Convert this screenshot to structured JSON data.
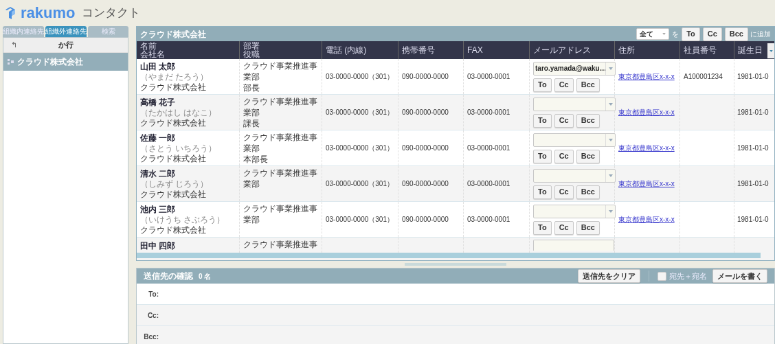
{
  "header": {
    "logo": "rakumo",
    "app_name": "コンタクト"
  },
  "sidebar": {
    "tabs": [
      {
        "label": "組織内連絡先",
        "selected": false
      },
      {
        "label": "組織外連絡先",
        "selected": true
      },
      {
        "label": "検索",
        "selected": false
      }
    ],
    "group_header": {
      "back": "↰",
      "label": "か行"
    },
    "items": [
      {
        "label": "クラウド株式会社",
        "selected": true
      }
    ]
  },
  "contacts": {
    "title": "クラウド株式会社",
    "toolbar": {
      "scope": "全て",
      "joiner": "を",
      "buttons": [
        "To",
        "Cc",
        "Bcc"
      ],
      "suffix": "に追加"
    },
    "columns": [
      [
        "名前",
        "会社名"
      ],
      [
        "部署",
        "役職"
      ],
      [
        "電話 (内線)"
      ],
      [
        "携帯番号"
      ],
      [
        "FAX"
      ],
      [
        "メールアドレス"
      ],
      [
        "住所"
      ],
      [
        "社員番号"
      ],
      [
        "誕生日"
      ]
    ],
    "rows": [
      {
        "kind": "full",
        "name": "山田 太郎",
        "reading": "（やまだ たろう）",
        "company": "クラウド株式会社",
        "department": "クラウド事業推進事業部",
        "title": "部長",
        "phone": "03-0000-0000（301）",
        "mobile": "090-0000-0000",
        "fax": "03-0000-0001",
        "email": "taro.yamada@waku…",
        "recipient_buttons": [
          "To",
          "Cc",
          "Bcc"
        ],
        "address": "東京都豊島区x-x-x",
        "employee_no": "A100001234",
        "birthday": "1981-01-0"
      },
      {
        "kind": "full",
        "name": "高橋 花子",
        "reading": "（たかはし はなこ）",
        "company": "クラウド株式会社",
        "department": "クラウド事業推進事業部",
        "title": "課長",
        "phone": "03-0000-0000（301）",
        "mobile": "090-0000-0000",
        "fax": "03-0000-0001",
        "recipient_buttons": [
          "To",
          "Cc",
          "Bcc"
        ],
        "address": "東京都豊島区x-x-x",
        "birthday": "1981-01-0"
      },
      {
        "kind": "full",
        "name": "佐藤 一郎",
        "reading": "（さとう いちろう）",
        "company": "クラウド株式会社",
        "department": "クラウド事業推進事業部",
        "title": "本部長",
        "phone": "03-0000-0000（301）",
        "mobile": "090-0000-0000",
        "fax": "03-0000-0001",
        "recipient_buttons": [
          "To",
          "Cc",
          "Bcc"
        ],
        "address": "東京都豊島区x-x-x",
        "birthday": "1981-01-0"
      },
      {
        "kind": "full",
        "name": "清水 二郎",
        "reading": "（しみず じろう）",
        "company": "クラウド株式会社",
        "department": "クラウド事業推進事業部",
        "phone": "03-0000-0000（301）",
        "mobile": "090-0000-0000",
        "fax": "03-0000-0001",
        "recipient_buttons": [
          "To",
          "Cc",
          "Bcc"
        ],
        "address": "東京都豊島区x-x-x",
        "birthday": "1981-01-0"
      },
      {
        "kind": "full",
        "name": "池内 三郎",
        "reading": "（いけうち さぶろう）",
        "company": "クラウド株式会社",
        "department": "クラウド事業推進事業部",
        "phone": "03-0000-0000（301）",
        "mobile": "090-0000-0000",
        "fax": "03-0000-0001",
        "recipient_buttons": [
          "To",
          "Cc",
          "Bcc"
        ],
        "address": "東京都豊島区x-x-x",
        "birthday": "1981-01-0"
      },
      {
        "kind": "partial",
        "name": "田中 四郎",
        "department": "クラウド事業推進事"
      }
    ]
  },
  "recipients": {
    "title": "送信先の確認",
    "count": "0 名",
    "clear_button": "送信先をクリア",
    "checkbox": {
      "label": "宛先＋宛名",
      "checked": false
    },
    "compose_button": "メールを書く",
    "fields": [
      {
        "label": "To:"
      },
      {
        "label": "Cc:"
      },
      {
        "label": "Bcc:"
      }
    ]
  }
}
